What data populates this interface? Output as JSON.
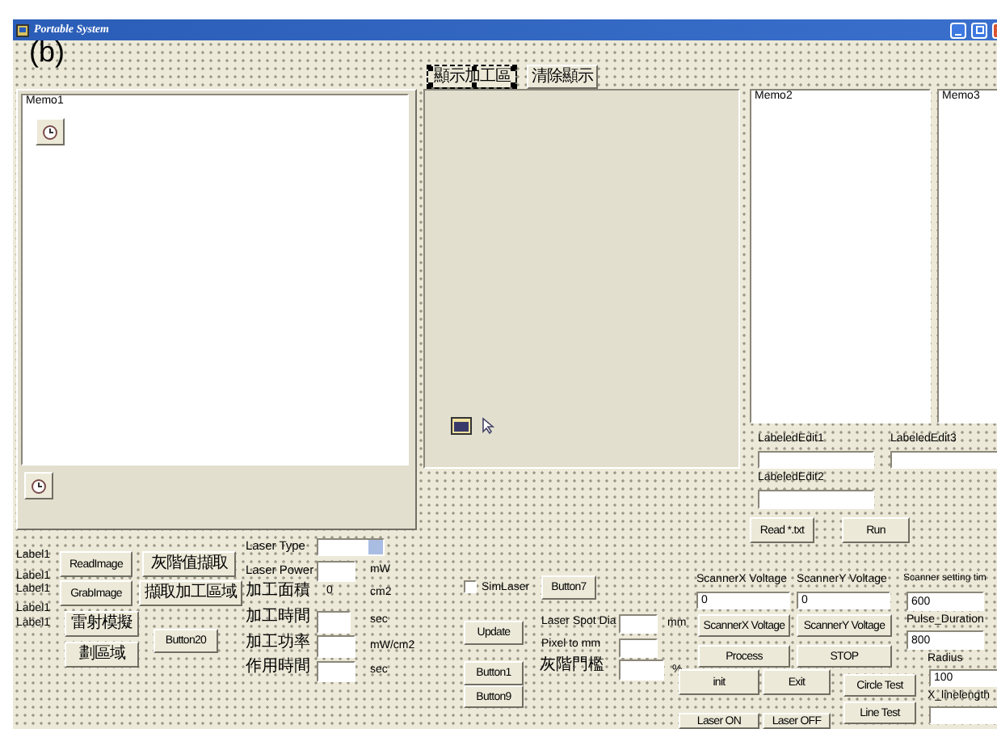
{
  "window": {
    "title": "Portable System"
  },
  "figure_label": "(b)",
  "controls": [
    {
      "kind": "button",
      "text": "顯示加工區",
      "selected": true
    },
    {
      "kind": "button",
      "text": "清除顯示",
      "selected": false
    },
    {
      "kind": "memo",
      "text": "Memo1"
    },
    {
      "kind": "memo",
      "text": "Memo2"
    },
    {
      "kind": "memo",
      "text": "Memo3"
    },
    {
      "kind": "label",
      "text": "Label1"
    },
    {
      "kind": "label",
      "text": "Label1"
    },
    {
      "kind": "label",
      "text": "Label1"
    },
    {
      "kind": "label",
      "text": "Label1"
    },
    {
      "kind": "label",
      "text": "Label1"
    },
    {
      "kind": "button",
      "text": "ReadImage",
      "selected": false
    },
    {
      "kind": "button",
      "text": "灰階值擷取",
      "selected": false
    },
    {
      "kind": "button",
      "text": "GrabImage",
      "selected": false
    },
    {
      "kind": "button",
      "text": "擷取加工區域",
      "selected": false
    },
    {
      "kind": "button",
      "text": "雷射模擬",
      "selected": false
    },
    {
      "kind": "button",
      "text": "劃區域",
      "selected": false
    },
    {
      "kind": "button",
      "text": "Button20",
      "selected": false
    },
    {
      "kind": "caption",
      "text": "Laser Type"
    },
    {
      "kind": "combo"
    },
    {
      "kind": "caption",
      "text": "Laser Power"
    },
    {
      "kind": "field"
    },
    {
      "kind": "label",
      "text": "mW"
    },
    {
      "kind": "caption",
      "text": "加工面積"
    },
    {
      "kind": "label",
      "text": "0"
    },
    {
      "kind": "label",
      "text": "cm2"
    },
    {
      "kind": "caption",
      "text": "加工時間"
    },
    {
      "kind": "field"
    },
    {
      "kind": "label",
      "text": "sec"
    },
    {
      "kind": "caption",
      "text": "加工功率"
    },
    {
      "kind": "field"
    },
    {
      "kind": "label",
      "text": "mW/cm2"
    },
    {
      "kind": "caption",
      "text": "作用時間"
    },
    {
      "kind": "field"
    },
    {
      "kind": "label",
      "text": "sec"
    },
    {
      "kind": "checkbox",
      "text": "SimLaser",
      "checked": false
    },
    {
      "kind": "button",
      "text": "Button7",
      "selected": false
    },
    {
      "kind": "button",
      "text": "Update",
      "selected": false
    },
    {
      "kind": "button",
      "text": "Button1",
      "selected": false
    },
    {
      "kind": "button",
      "text": "Button9",
      "selected": false
    },
    {
      "kind": "label",
      "text": "Laser Spot Dia"
    },
    {
      "kind": "field"
    },
    {
      "kind": "label",
      "text": "mm"
    },
    {
      "kind": "label",
      "text": "Pixel to mm"
    },
    {
      "kind": "field"
    },
    {
      "kind": "label",
      "text": "灰階門檻"
    },
    {
      "kind": "field"
    },
    {
      "kind": "label",
      "text": "%"
    },
    {
      "kind": "label",
      "text": "LabeledEdit1"
    },
    {
      "kind": "field"
    },
    {
      "kind": "label",
      "text": "LabeledEdit3"
    },
    {
      "kind": "field"
    },
    {
      "kind": "label",
      "text": "LabeledEdit2"
    },
    {
      "kind": "field"
    },
    {
      "kind": "button",
      "text": "Read *.txt",
      "selected": false
    },
    {
      "kind": "button",
      "text": "Run",
      "selected": false
    },
    {
      "kind": "label",
      "text": "ScannerX Voltage"
    },
    {
      "kind": "field",
      "value": "0"
    },
    {
      "kind": "label",
      "text": "ScannerY Voltage"
    },
    {
      "kind": "field",
      "value": "0"
    },
    {
      "kind": "label",
      "text": "Scanner setting tim"
    },
    {
      "kind": "field",
      "value": "600"
    },
    {
      "kind": "button",
      "text": "ScannerX Voltage",
      "selected": false
    },
    {
      "kind": "button",
      "text": "ScannerY Voltage",
      "selected": false
    },
    {
      "kind": "label",
      "text": "Pulse_Duration"
    },
    {
      "kind": "field",
      "value": "800"
    },
    {
      "kind": "button",
      "text": "Process",
      "selected": false
    },
    {
      "kind": "button",
      "text": "STOP",
      "selected": false
    },
    {
      "kind": "label",
      "text": "Radius"
    },
    {
      "kind": "field",
      "value": "100"
    },
    {
      "kind": "button",
      "text": "init",
      "selected": false
    },
    {
      "kind": "button",
      "text": "Exit",
      "selected": false
    },
    {
      "kind": "button",
      "text": "Circle Test",
      "selected": false
    },
    {
      "kind": "label",
      "text": "X_linelength"
    },
    {
      "kind": "field"
    },
    {
      "kind": "button",
      "text": "Line Test",
      "selected": false
    },
    {
      "kind": "button",
      "text": "Laser ON",
      "selected": false
    },
    {
      "kind": "button",
      "text": "Laser OFF",
      "selected": false
    }
  ]
}
